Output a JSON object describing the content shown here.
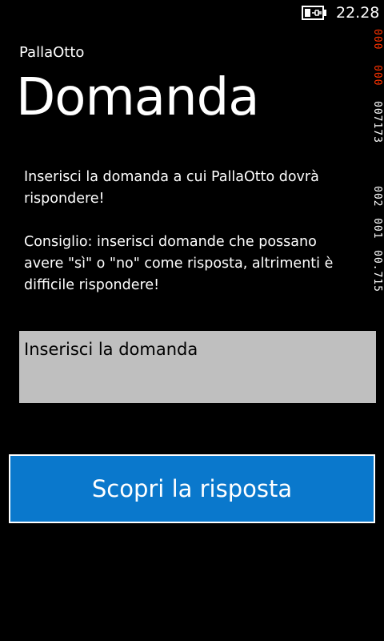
{
  "status_bar": {
    "time": "22.28",
    "battery_icon": "battery-charging-icon"
  },
  "debug_counter": {
    "values": [
      "000",
      "000",
      "007173",
      "002",
      "001",
      "00.715"
    ],
    "alert_color": "#ff3300",
    "text_color": "#ffffff"
  },
  "header": {
    "app_name": "PallaOtto",
    "page_title": "Domanda"
  },
  "description": {
    "paragraph_1": "Inserisci  la domanda a cui PallaOtto dovrà rispondere!",
    "paragraph_2": "Consiglio: inserisci domande che possano avere \"sì\" o \"no\" come risposta, altrimenti è difficile rispondere!"
  },
  "question": {
    "placeholder": "Inserisci la domanda",
    "value": ""
  },
  "actions": {
    "answer_button_label": "Scopri la risposta"
  },
  "colors": {
    "background": "#000000",
    "accent": "#0a78cc",
    "input_background": "#bfbfbf",
    "text": "#ffffff"
  }
}
